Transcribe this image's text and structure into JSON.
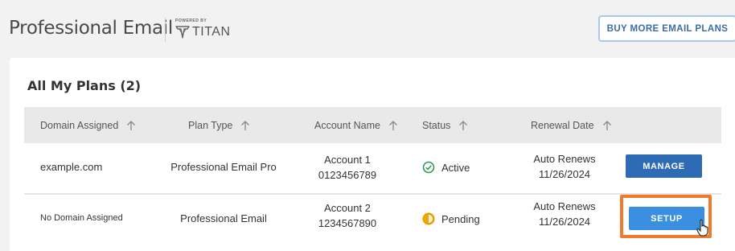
{
  "header": {
    "title": "Professional Email",
    "powered_by": "POWERED BY",
    "brand": "TITAN",
    "buy_button": "BUY MORE EMAIL PLANS"
  },
  "plans": {
    "title": "All My Plans (2)",
    "columns": [
      "Domain Assigned",
      "Plan Type",
      "Account Name",
      "Status",
      "Renewal Date"
    ],
    "rows": [
      {
        "domain": "example.com",
        "plan_type": "Professional Email Pro",
        "account_name": "Account 1",
        "account_number": "0123456789",
        "status": "Active",
        "renewal_line1": "Auto Renews",
        "renewal_line2": "11/26/2024",
        "action": "MANAGE"
      },
      {
        "domain": "No Domain Assigned",
        "plan_type": "Professional Email",
        "account_name": "Account 2",
        "account_number": "1234567890",
        "status": "Pending",
        "renewal_line1": "Auto Renews",
        "renewal_line2": "11/26/2024",
        "action": "SETUP"
      }
    ]
  },
  "colors": {
    "active_status": "#2e9b4f",
    "pending_status": "#f0a500",
    "manage_button": "#2d6bb5",
    "setup_button": "#3b8fe0",
    "highlight": "#f07a2d"
  },
  "icons": {
    "sort": "arrow-up-icon",
    "active": "check-circle-icon",
    "pending": "half-circle-clock-icon",
    "cursor": "hand-pointer-icon"
  }
}
